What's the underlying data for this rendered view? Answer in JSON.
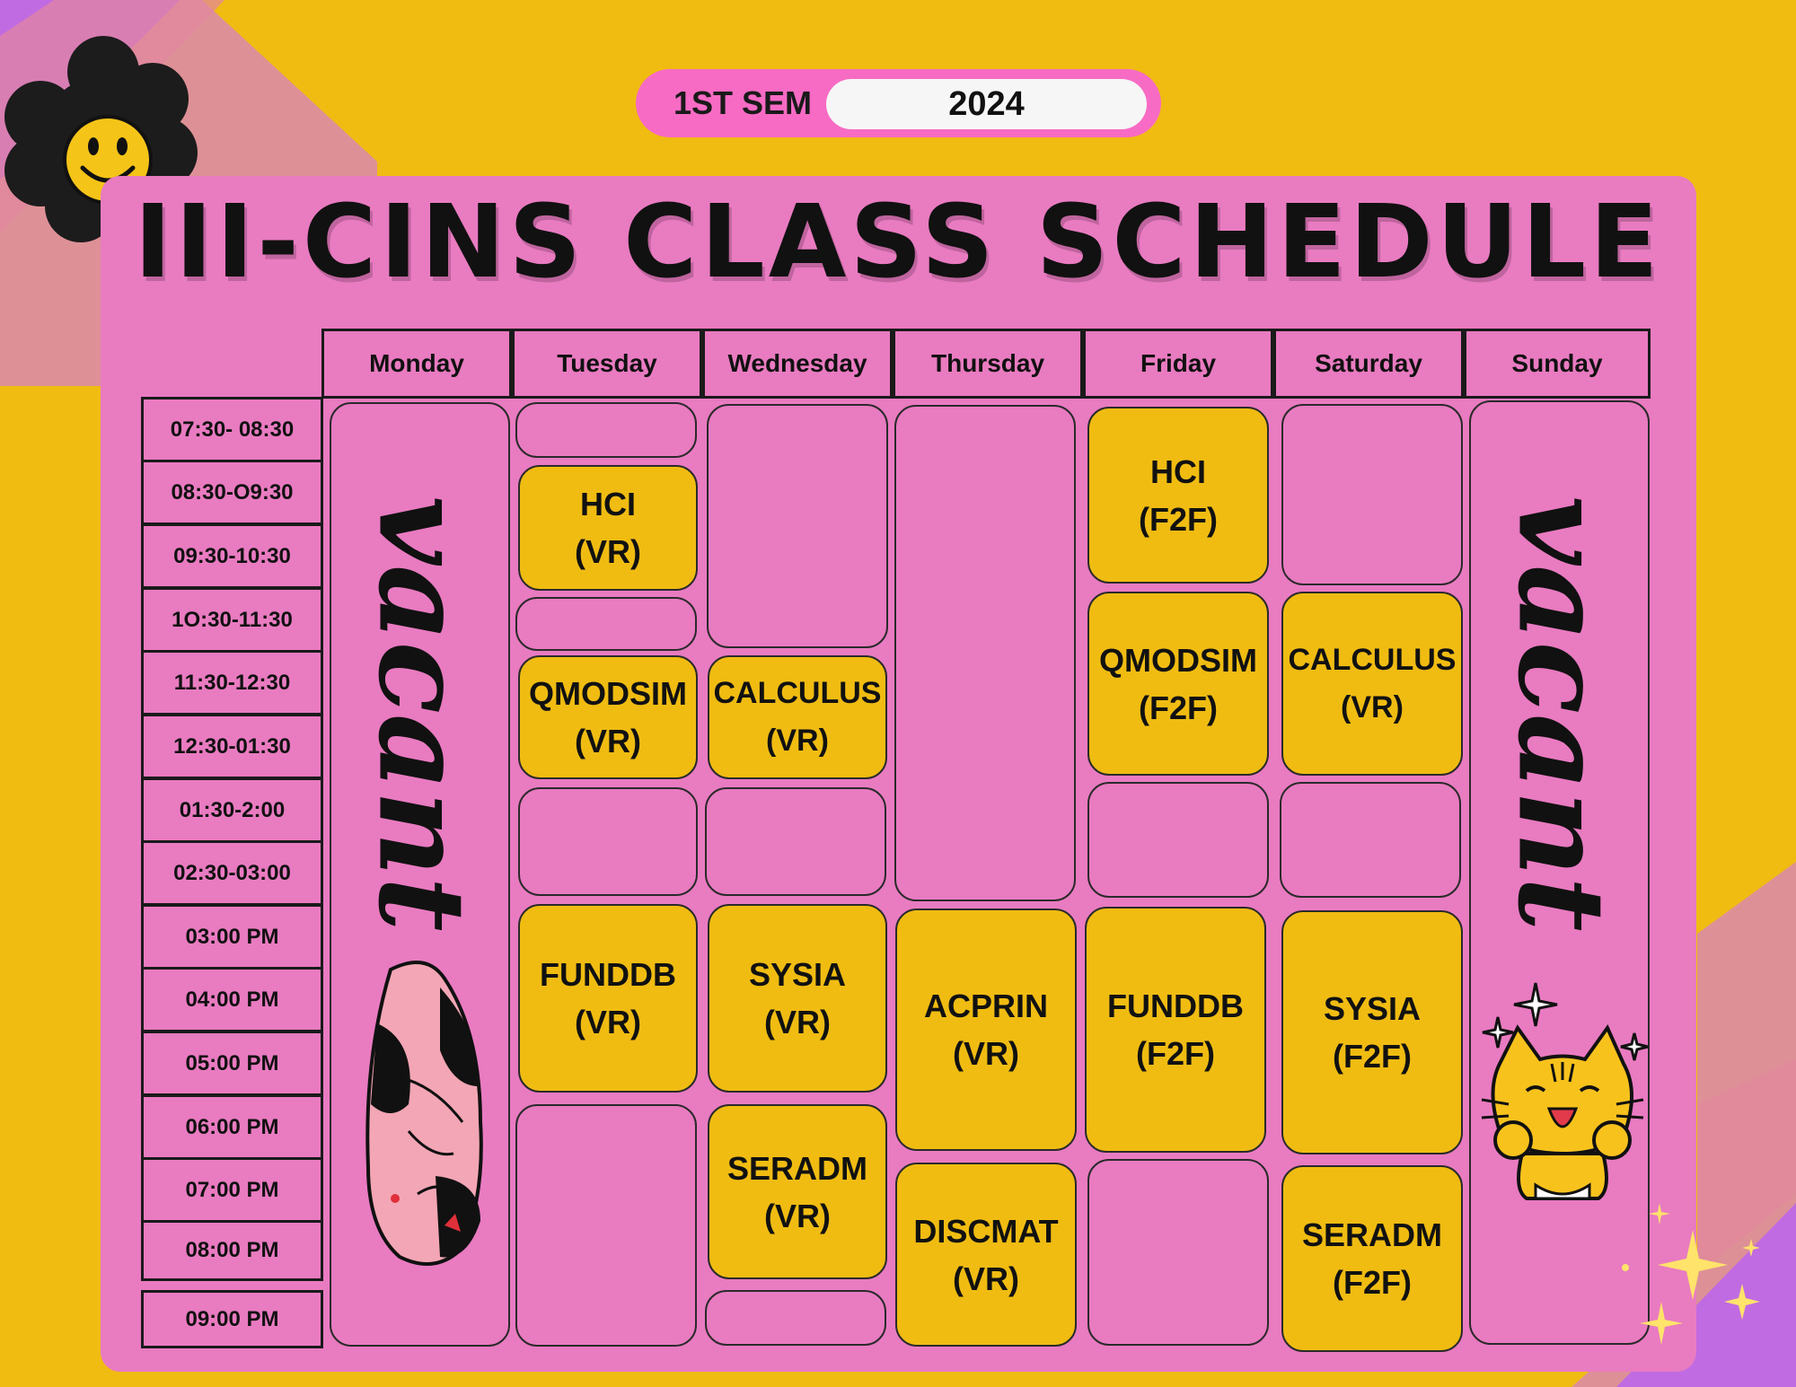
{
  "header": {
    "semester": "1ST SEM",
    "year": "2024",
    "title": "III-CINS CLASS SCHEDULE"
  },
  "days": [
    "Monday",
    "Tuesday",
    "Wednesday",
    "Thursday",
    "Friday",
    "Saturday",
    "Sunday"
  ],
  "times": [
    "07:30- 08:30",
    "08:30-O9:30",
    "09:30-10:30",
    "1O:30-11:30",
    "11:30-12:30",
    "12:30-01:30",
    "01:30-2:00",
    "02:30-03:00",
    "03:00 PM",
    "04:00 PM",
    "05:00 PM",
    "06:00 PM",
    "07:00 PM",
    "08:00 PM",
    "09:00 PM"
  ],
  "vacant": {
    "monday": "vacant",
    "sunday": "vacant"
  },
  "classes": {
    "tue_hci": {
      "name": "HCI",
      "mode": "(VR)"
    },
    "tue_qmodsim": {
      "name": "QMODSIM",
      "mode": "(VR)"
    },
    "tue_funddb": {
      "name": "FUNDDB",
      "mode": "(VR)"
    },
    "wed_calculus": {
      "name": "CALCULUS",
      "mode": "(VR)"
    },
    "wed_sysia": {
      "name": "SYSIA",
      "mode": "(VR)"
    },
    "wed_seradm": {
      "name": "SERADM",
      "mode": "(VR)"
    },
    "thu_acprin": {
      "name": "ACPRIN",
      "mode": "(VR)"
    },
    "thu_discmat": {
      "name": "DISCMAT",
      "mode": "(VR)"
    },
    "fri_hci": {
      "name": "HCI",
      "mode": "(F2F)"
    },
    "fri_qmodsim": {
      "name": "QMODSIM",
      "mode": "(F2F)"
    },
    "fri_funddb": {
      "name": "FUNDDB",
      "mode": "(F2F)"
    },
    "sat_calculus": {
      "name": "CALCULUS",
      "mode": "(VR)"
    },
    "sat_sysia": {
      "name": "SYSIA",
      "mode": "(F2F)"
    },
    "sat_seradm": {
      "name": "SERADM",
      "mode": "(F2F)"
    }
  },
  "colors": {
    "background": "#F0BC12",
    "panel": "#E97BC1",
    "class_block": "#F0BC12",
    "pill": "#F76BC4",
    "accent_purple": "#B866E0"
  },
  "icons": [
    "smiley-flower-icon",
    "sleeping-cat-icon",
    "happy-cat-icon",
    "sparkle-icon"
  ]
}
